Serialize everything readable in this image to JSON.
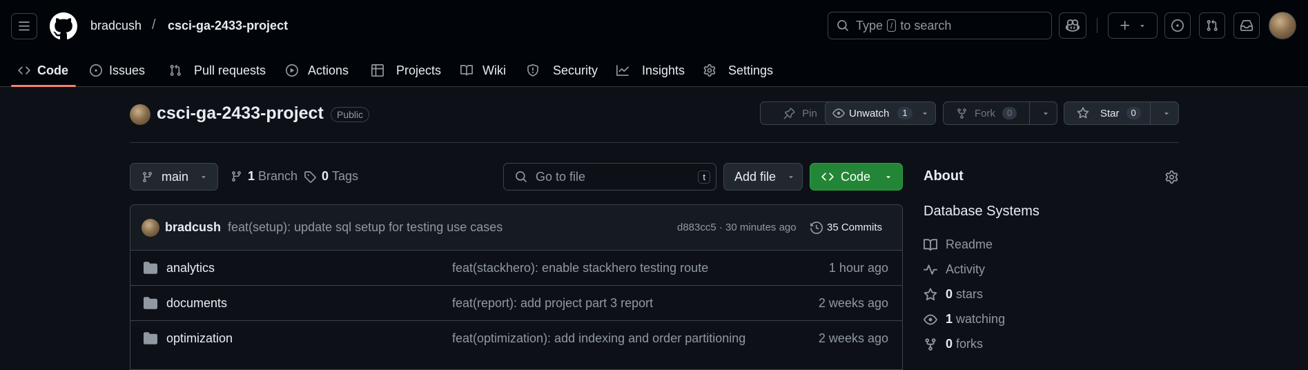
{
  "header": {
    "owner": "bradcush",
    "separator": "/",
    "repo": "csci-ga-2433-project",
    "search_prefix": "Type",
    "search_key": "/",
    "search_suffix": "to search"
  },
  "nav": [
    {
      "label": "Code",
      "icon": "code-icon"
    },
    {
      "label": "Issues",
      "icon": "issue-icon"
    },
    {
      "label": "Pull requests",
      "icon": "pull-request-icon"
    },
    {
      "label": "Actions",
      "icon": "play-icon"
    },
    {
      "label": "Projects",
      "icon": "table-icon"
    },
    {
      "label": "Wiki",
      "icon": "book-icon"
    },
    {
      "label": "Security",
      "icon": "shield-icon"
    },
    {
      "label": "Insights",
      "icon": "graph-icon"
    },
    {
      "label": "Settings",
      "icon": "gear-icon"
    }
  ],
  "repo": {
    "name": "csci-ga-2433-project",
    "visibility": "Public",
    "pin": "Pin",
    "unwatch": "Unwatch",
    "watch_count": "1",
    "fork": "Fork",
    "fork_count": "0",
    "star": "Star",
    "star_count": "0"
  },
  "toolbar": {
    "branch": "main",
    "branch_count": "1",
    "branch_label": "Branch",
    "tag_count": "0",
    "tag_label": "Tags",
    "goto_placeholder": "Go to file",
    "goto_key": "t",
    "add_file": "Add file",
    "code": "Code"
  },
  "commit": {
    "author": "bradcush",
    "message": "feat(setup): update sql setup for testing use cases",
    "meta": "d883cc5 · 30 minutes ago",
    "count": "35 Commits"
  },
  "files": [
    {
      "name": "analytics",
      "message": "feat(stackhero): enable stackhero testing route",
      "time": "1 hour ago"
    },
    {
      "name": "documents",
      "message": "feat(report): add project part 3 report",
      "time": "2 weeks ago"
    },
    {
      "name": "optimization",
      "message": "feat(optimization): add indexing and order partitioning",
      "time": "2 weeks ago"
    }
  ],
  "about": {
    "title": "About",
    "description": "Database Systems",
    "readme": "Readme",
    "activity": "Activity",
    "stars_count": "0",
    "stars_label": "stars",
    "watching_count": "1",
    "watching_label": "watching",
    "forks_count": "0",
    "forks_label": "forks"
  },
  "colors": {
    "accent_green": "#238636",
    "underline": "#f78166",
    "bg": "#0d1117"
  }
}
